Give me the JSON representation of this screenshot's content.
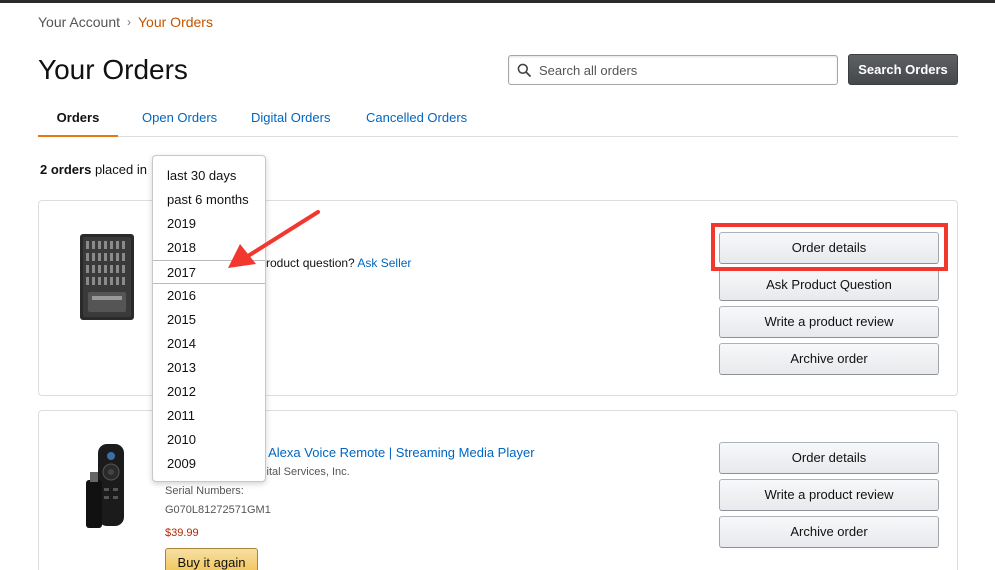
{
  "breadcrumb": {
    "account": "Your Account",
    "separator": "›",
    "current": "Your Orders"
  },
  "page_title": "Your Orders",
  "search": {
    "placeholder": "Search all orders",
    "button_label": "Search Orders"
  },
  "tabs": [
    {
      "label": "Orders",
      "active": true
    },
    {
      "label": "Open Orders",
      "active": false
    },
    {
      "label": "Digital Orders",
      "active": false
    },
    {
      "label": "Cancelled Orders",
      "active": false
    }
  ],
  "orders_summary": {
    "count_text": "2 orders",
    "placed_in_text": "placed in"
  },
  "time_filter": {
    "options": [
      "last 30 days",
      "past 6 months",
      "2019",
      "2018",
      "2017",
      "2016",
      "2015",
      "2014",
      "2013",
      "2012",
      "2011",
      "2010",
      "2009"
    ],
    "highlighted_option": "2017"
  },
  "orders": [
    {
      "product_question_prefix": "Product question?",
      "ask_seller_label": "Ask Seller",
      "actions": [
        "Order details",
        "Ask Product Question",
        "Write a product review",
        "Archive order"
      ]
    },
    {
      "title_visible": "n Alexa Voice Remote | Streaming Media Player",
      "seller_visible": "igital Services, Inc.",
      "serial_label": "Serial Numbers:",
      "serial_value": "G070L81272571GM1",
      "price": "$39.99",
      "buy_again_label": "Buy it again",
      "actions": [
        "Order details",
        "Write a product review",
        "Archive order"
      ]
    }
  ],
  "colors": {
    "link": "#0066c0",
    "breadcrumb_current": "#c45500",
    "tab_underline": "#e47911",
    "annotation_red": "#f2372e",
    "price": "#b12704",
    "buy_button": "#f0c14b"
  }
}
